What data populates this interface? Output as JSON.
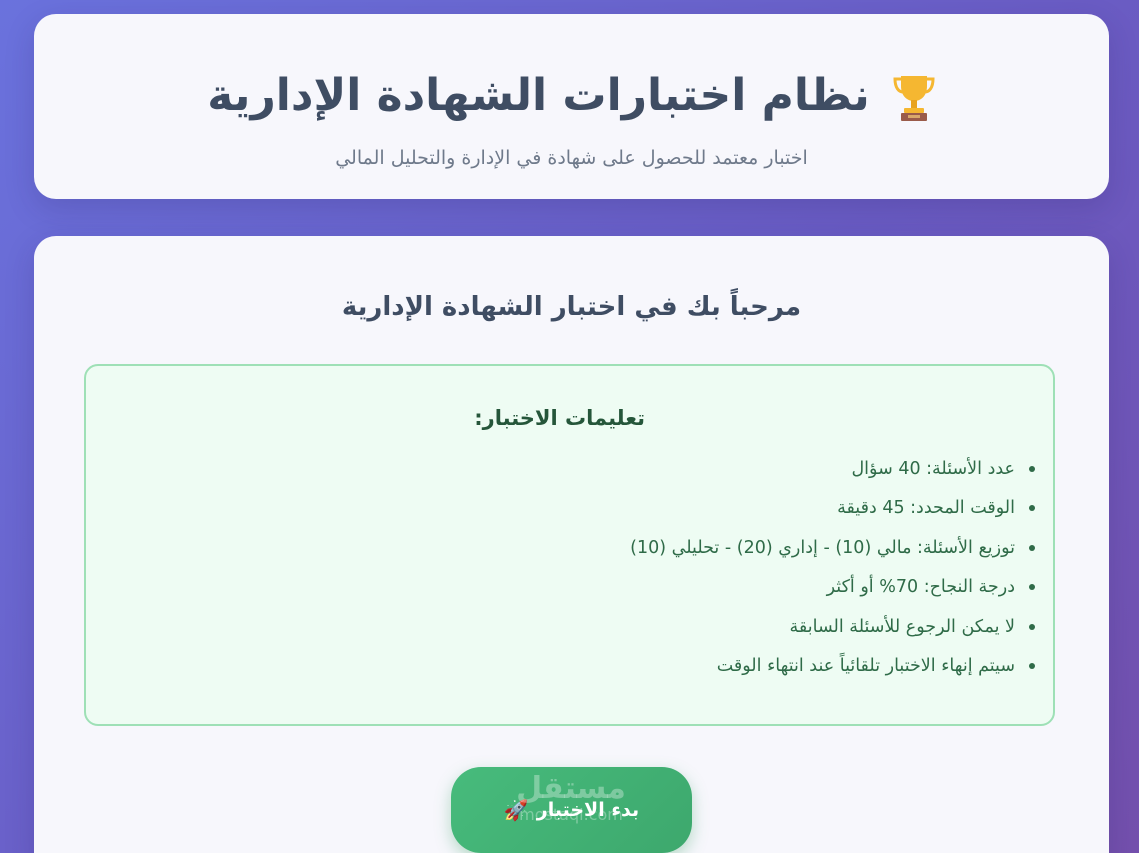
{
  "header": {
    "title": "نظام اختبارات الشهادة الإدارية",
    "title_icon": "trophy-icon",
    "subtitle": "اختبار معتمد للحصول على شهادة في الإدارة والتحليل المالي"
  },
  "main": {
    "welcome": "مرحباً بك في اختبار الشهادة الإدارية",
    "instructions": {
      "title": "تعليمات الاختبار:",
      "items": [
        "عدد الأسئلة: 40 سؤال",
        "الوقت المحدد: 45 دقيقة",
        "توزيع الأسئلة: مالي (10) - إداري (20) - تحليلي (10)",
        "درجة النجاح: 70% أو أكثر",
        "لا يمكن الرجوع للأسئلة السابقة",
        "سيتم إنهاء الاختبار تلقائياً عند انتهاء الوقت"
      ]
    },
    "start_button": {
      "label": "بدء الاختبار",
      "icon": "rocket-icon"
    }
  },
  "watermark": {
    "arabic": "مستقل",
    "latin": "mostaql.com"
  },
  "colors": {
    "background_start": "#6a72dd",
    "background_end": "#7450ad",
    "card": "#f7f7fc",
    "title_text": "#3f4d63",
    "instructions_bg": "#eefcf3",
    "instructions_border": "#9ee0b6",
    "instructions_text": "#2f6b48",
    "button": "#47bb7c"
  }
}
